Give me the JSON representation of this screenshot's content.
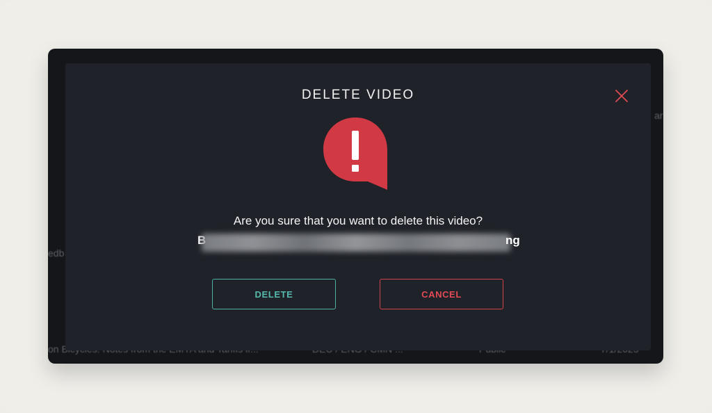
{
  "background": {
    "right_fragment": "ar",
    "left_fragment": "edb",
    "bottom_row": {
      "title": "on Bicycles: Notes from the EMYA and Tariffs if...",
      "languages": "DEU / ENG / CMN ...",
      "visibility": "Public",
      "date": "7/1/2025"
    }
  },
  "dialog": {
    "title": "DELETE VIDEO",
    "message": "Are you sure that you want to delete this video?",
    "video_name": {
      "first_char": "B",
      "last_chars": "ng"
    },
    "delete_label": "DELETE",
    "cancel_label": "CANCEL",
    "icons": {
      "close": "close-icon",
      "alert": "exclamation-speech-bubble-icon"
    }
  },
  "colors": {
    "accent_delete": "#56b9ad",
    "accent_cancel": "#e24b53",
    "alert_red": "#d13a44",
    "modal_bg": "#1f2228"
  }
}
